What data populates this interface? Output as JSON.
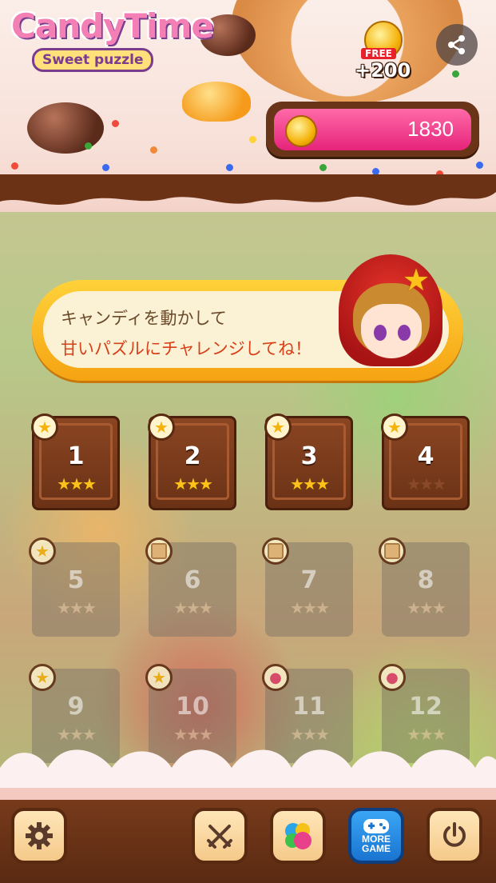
{
  "logo": {
    "title": "CandyTime",
    "subtitle": "Sweet puzzle"
  },
  "free_bonus": {
    "label": "FREE",
    "amount": "+200"
  },
  "coins": {
    "value": "1830"
  },
  "banner": {
    "line1": "キャンディを動かして",
    "line2": "甘いパズルにチャレンジしてね！"
  },
  "levels": [
    {
      "num": "1",
      "state": "unlocked",
      "badge": "star-icon",
      "stars": 3
    },
    {
      "num": "2",
      "state": "unlocked",
      "badge": "star-icon",
      "stars": 3
    },
    {
      "num": "3",
      "state": "unlocked",
      "badge": "star-icon",
      "stars": 3
    },
    {
      "num": "4",
      "state": "unlocked",
      "badge": "star-icon",
      "stars": 0
    },
    {
      "num": "5",
      "state": "locked",
      "badge": "star-icon",
      "stars": 0
    },
    {
      "num": "6",
      "state": "locked",
      "badge": "box-icon",
      "stars": 0
    },
    {
      "num": "7",
      "state": "locked",
      "badge": "box-icon",
      "stars": 0
    },
    {
      "num": "8",
      "state": "locked",
      "badge": "box-icon",
      "stars": 0
    },
    {
      "num": "9",
      "state": "locked",
      "badge": "star-icon",
      "stars": 0
    },
    {
      "num": "10",
      "state": "locked",
      "badge": "star-icon",
      "stars": 0
    },
    {
      "num": "11",
      "state": "locked",
      "badge": "cupcake-icon",
      "stars": 0
    },
    {
      "num": "12",
      "state": "locked",
      "badge": "cupcake-icon",
      "stars": 0
    }
  ],
  "bottom_bar": {
    "buttons": [
      "gear-icon",
      "crossed-swords-icon",
      "game-center-icon",
      "more-game-icon",
      "power-icon"
    ],
    "more_game_label_1": "MORE",
    "more_game_label_2": "GAME"
  },
  "colors": {
    "coin_bar": "#e6237a",
    "star_filled": "#ffc21a",
    "star_empty": "#8a4a2a",
    "banner_orange": "#f5a312"
  }
}
